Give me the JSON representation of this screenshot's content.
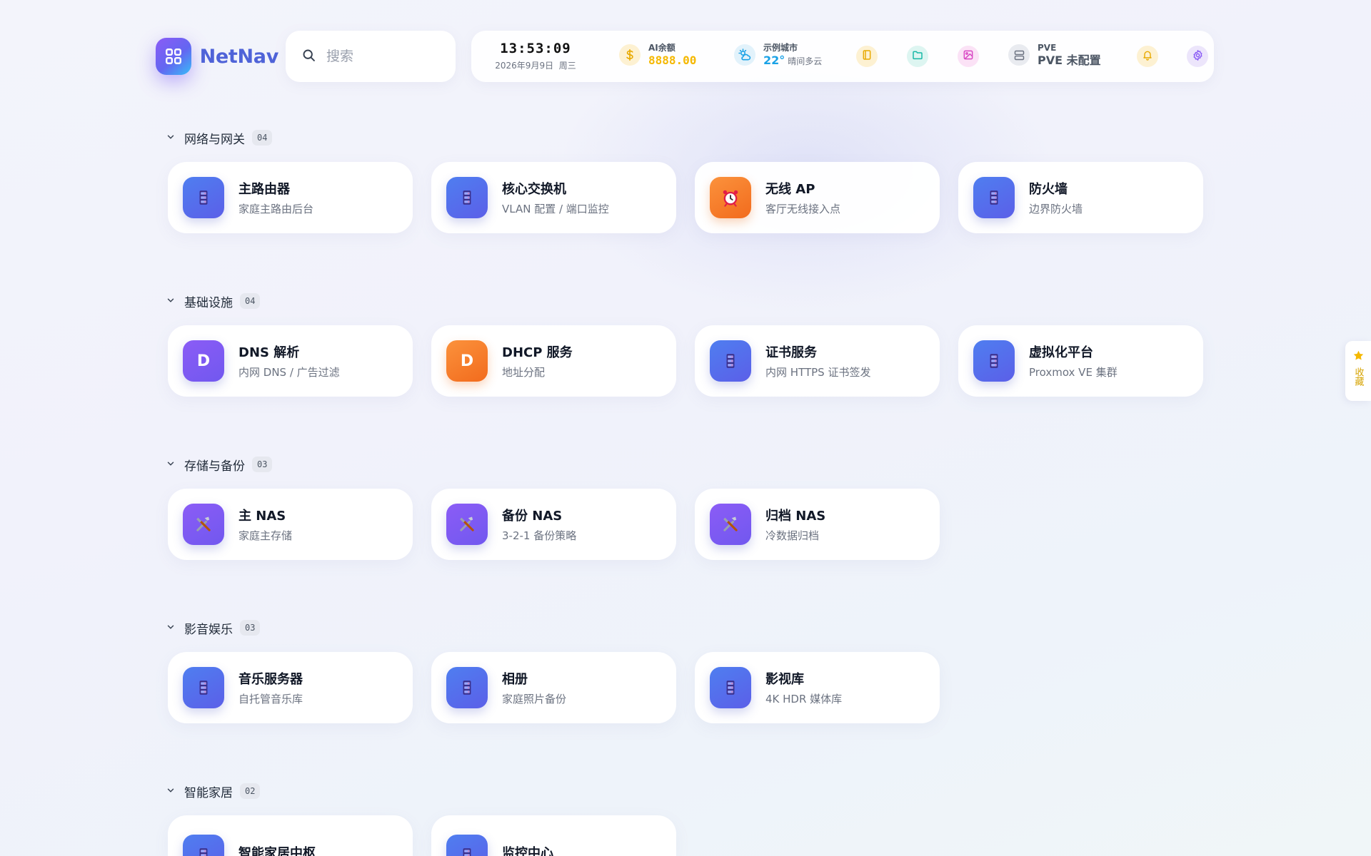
{
  "app": {
    "name": "NetNav"
  },
  "search": {
    "placeholder": "搜索"
  },
  "status": {
    "time": "13:53:09",
    "date": "2026年9月9日",
    "weekday": "周三",
    "ai_balance": {
      "label": "AI余额",
      "value": "8888.00",
      "icon": "dollar-icon",
      "color": "#f5b800"
    },
    "weather": {
      "label": "示例城市",
      "temp": "22°",
      "desc": "晴间多云",
      "icon": "weather-cloud-sun-icon",
      "color": "#1aa2e6"
    },
    "pve": {
      "label": "PVE",
      "value": "PVE 未配置",
      "icon": "server-icon"
    },
    "buttons": [
      "book-icon",
      "folder-icon",
      "image-icon",
      "bell-icon",
      "gear-icon"
    ]
  },
  "sections": [
    {
      "title": "网络与网关",
      "count": "04",
      "items": [
        {
          "title": "主路由器",
          "desc": "家庭主路由后台",
          "icon": "server-rack-icon",
          "color": "blue"
        },
        {
          "title": "核心交换机",
          "desc": "VLAN 配置 / 端口监控",
          "icon": "server-rack-icon",
          "color": "blue"
        },
        {
          "title": "无线 AP",
          "desc": "客厅无线接入点",
          "icon": "alarm-clock-icon",
          "color": "orange"
        },
        {
          "title": "防火墙",
          "desc": "边界防火墙",
          "icon": "server-rack-icon",
          "color": "blue"
        }
      ]
    },
    {
      "title": "基础设施",
      "count": "04",
      "items": [
        {
          "title": "DNS 解析",
          "desc": "内网 DNS / 广告过滤",
          "letter": "D",
          "icon": "letter-d-icon",
          "color": "purple"
        },
        {
          "title": "DHCP 服务",
          "desc": "地址分配",
          "letter": "D",
          "icon": "letter-d-icon",
          "color": "orange"
        },
        {
          "title": "证书服务",
          "desc": "内网 HTTPS 证书签发",
          "icon": "server-rack-icon",
          "color": "blue"
        },
        {
          "title": "虚拟化平台",
          "desc": "Proxmox VE 集群",
          "icon": "server-rack-icon",
          "color": "blue"
        }
      ]
    },
    {
      "title": "存储与备份",
      "count": "03",
      "items": [
        {
          "title": "主 NAS",
          "desc": "家庭主存储",
          "icon": "tools-icon",
          "color": "purple"
        },
        {
          "title": "备份 NAS",
          "desc": "3-2-1 备份策略",
          "icon": "tools-icon",
          "color": "purple"
        },
        {
          "title": "归档 NAS",
          "desc": "冷数据归档",
          "icon": "tools-icon",
          "color": "purple"
        }
      ]
    },
    {
      "title": "影音娱乐",
      "count": "03",
      "items": [
        {
          "title": "音乐服务器",
          "desc": "自托管音乐库",
          "icon": "server-rack-icon",
          "color": "blue"
        },
        {
          "title": "相册",
          "desc": "家庭照片备份",
          "icon": "server-rack-icon",
          "color": "blue"
        },
        {
          "title": "影视库",
          "desc": "4K HDR 媒体库",
          "icon": "server-rack-icon",
          "color": "blue"
        }
      ]
    },
    {
      "title": "智能家居",
      "count": "02",
      "items": [
        {
          "title": "智能家居中枢",
          "desc": "",
          "icon": "server-rack-icon",
          "color": "blue"
        },
        {
          "title": "监控中心",
          "desc": "",
          "icon": "server-rack-icon",
          "color": "blue"
        }
      ]
    }
  ],
  "favorites": {
    "label": "收藏",
    "icon": "star-icon"
  }
}
